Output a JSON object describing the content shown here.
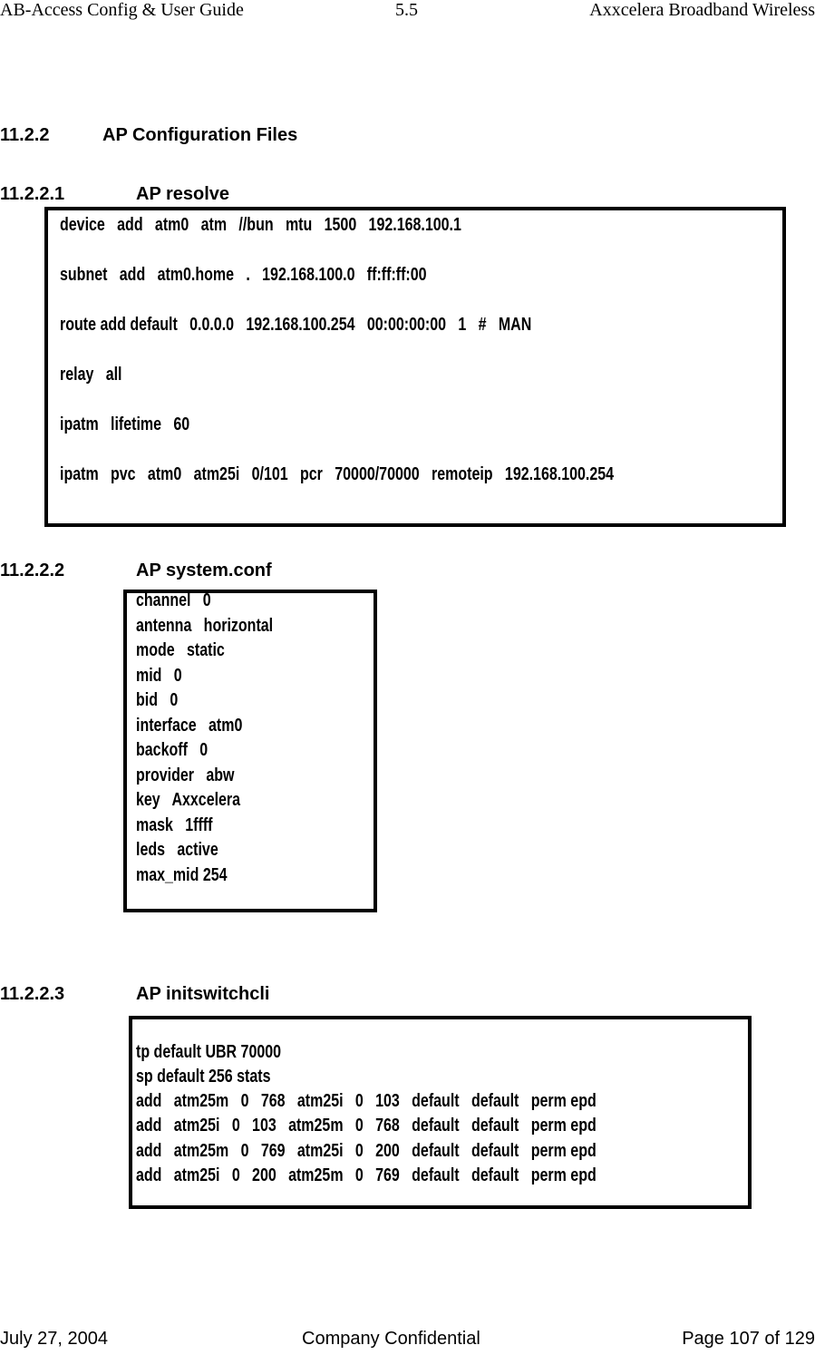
{
  "header": {
    "left": "AB-Access Config & User Guide",
    "center": "5.5",
    "right": "Axxcelera Broadband Wireless"
  },
  "section": {
    "number": "11.2.2",
    "title": "AP Configuration Files"
  },
  "subsections": [
    {
      "number": "11.2.2.1",
      "title": "AP resolve",
      "lines": [
        "device   add   atm0   atm   //bun   mtu   1500   192.168.100.1",
        "subnet   add   atm0.home   .   192.168.100.0   ff:ff:ff:00",
        "route add default   0.0.0.0   192.168.100.254   00:00:00:00   1   #   MAN",
        "relay   all",
        "ipatm   lifetime   60",
        "ipatm   pvc   atm0   atm25i   0/101   pcr   70000/70000   remoteip   192.168.100.254"
      ]
    },
    {
      "number": "11.2.2.2",
      "title": "AP system.conf",
      "lines": [
        "channel   0",
        "antenna   horizontal",
        "mode   static",
        "mid   0",
        "bid   0",
        "interface   atm0",
        "backoff   0",
        "provider   abw",
        "key   Axxcelera",
        "mask   1ffff",
        "leds   active",
        "max_mid 254"
      ]
    },
    {
      "number": "11.2.2.3",
      "title": "AP initswitchcli",
      "lines": [
        "tp default UBR 70000",
        "sp default 256 stats",
        "add   atm25m   0   768   atm25i   0   103   default   default   perm epd",
        "add   atm25i   0   103   atm25m   0   768   default   default   perm epd",
        "add   atm25m   0   769   atm25i   0   200   default   default   perm epd",
        "add   atm25i   0   200   atm25m   0   769   default   default   perm epd"
      ]
    }
  ],
  "footer": {
    "date": "July 27, 2004",
    "center": "Company Confidential",
    "page": "Page 107 of 129"
  }
}
